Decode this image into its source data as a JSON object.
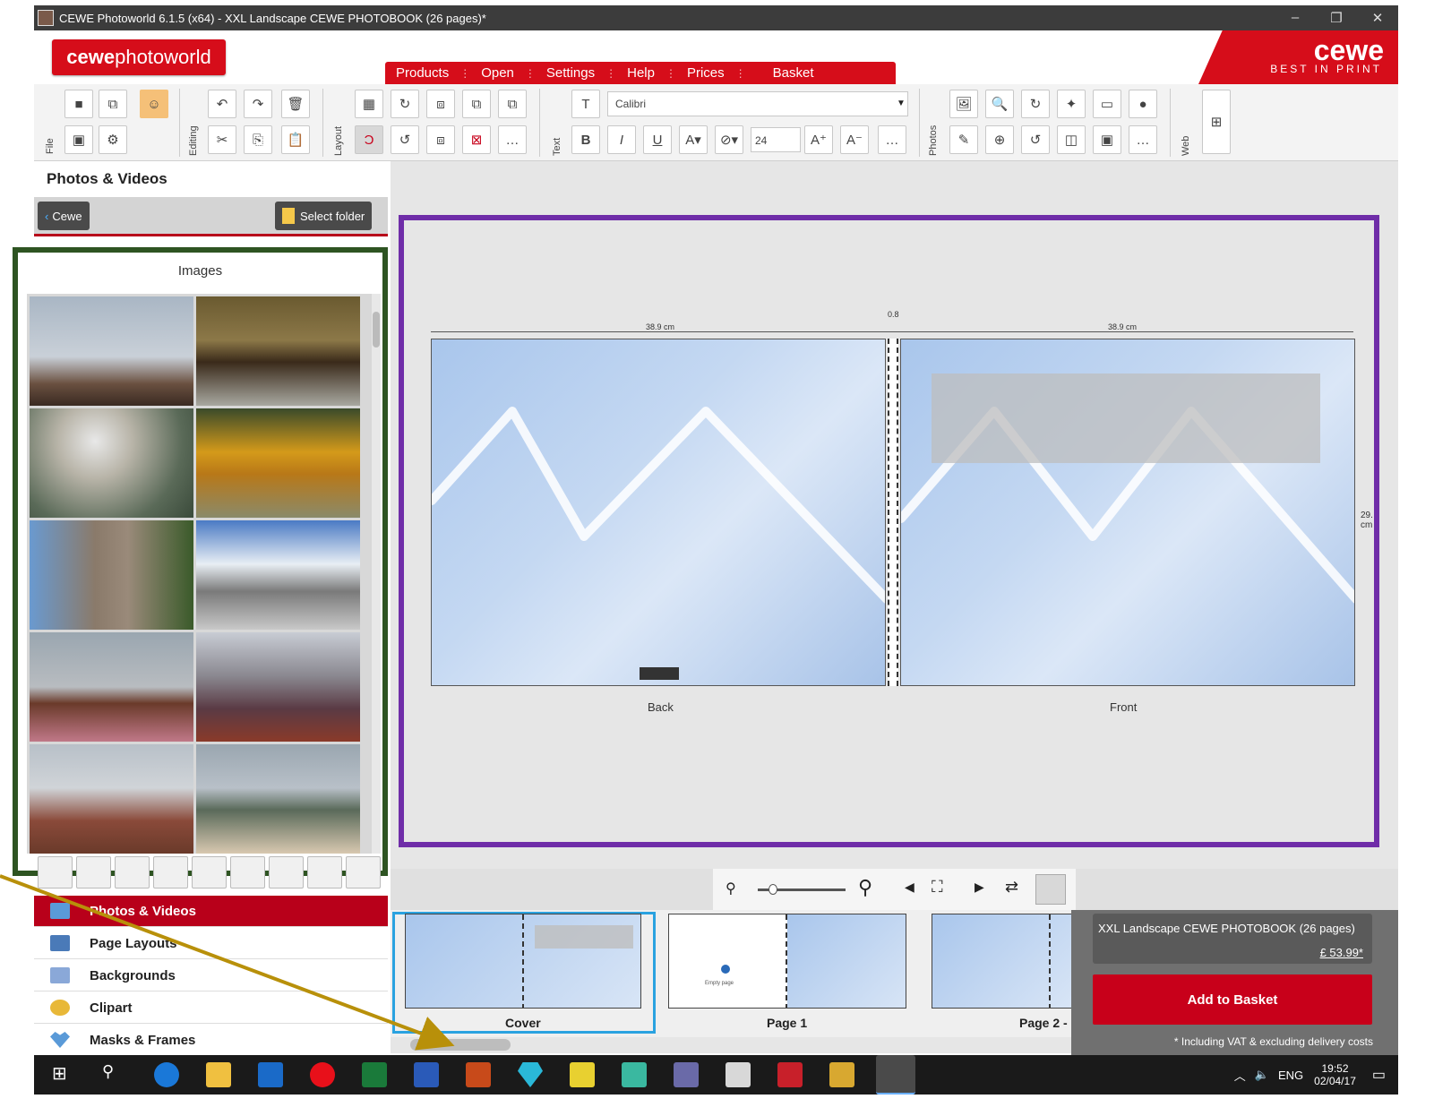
{
  "window": {
    "title": "CEWE Photoworld 6.1.5 (x64) - XXL Landscape CEWE PHOTOBOOK (26 pages)*",
    "minimize": "–",
    "restore": "❐",
    "close": "✕"
  },
  "header": {
    "logo_bold": "cewe",
    "logo_light": "photoworld",
    "brand_big": "cewe",
    "brand_small": "BEST IN PRINT",
    "menu": [
      "Products",
      "Open",
      "Settings",
      "Help",
      "Prices",
      "Basket"
    ]
  },
  "toolbar": {
    "groups": {
      "file": "File",
      "editing": "Editing",
      "layout": "Layout",
      "text": "Text",
      "photos": "Photos",
      "web": "Web"
    },
    "font_name": "Calibri",
    "font_size": "24",
    "bold": "B",
    "italic": "I",
    "underline": "U",
    "grow": "A⁺",
    "shrink": "A⁻",
    "more": "…"
  },
  "left_panel": {
    "title": "Photos & Videos",
    "back_button": "Cewe",
    "select_folder": "Select folder",
    "images_title": "Images",
    "categories": [
      "Photos & Videos",
      "Page Layouts",
      "Backgrounds",
      "Clipart",
      "Masks & Frames"
    ]
  },
  "canvas": {
    "width_left": "38.9 cm",
    "spine": "0.8",
    "width_right": "38.9 cm",
    "height": "29.  cm",
    "back_label": "Back",
    "front_label": "Front"
  },
  "filmstrip": {
    "items": [
      "Cover",
      "Page 1",
      "Page 2 -"
    ],
    "empty_page": "Empty page"
  },
  "order": {
    "product": "XXL Landscape CEWE PHOTOBOOK (26 pages)",
    "price": "£ 53.99*",
    "add_button": "Add to Basket",
    "vat_note": "* Including VAT & excluding delivery costs"
  },
  "taskbar": {
    "lang": "ENG",
    "time": "19:52",
    "date": "02/04/17"
  },
  "colors": {
    "brand_red": "#d60d1a",
    "frame_green": "#2e5422",
    "frame_purple": "#6f2da8",
    "arrow_gold": "#b8900a"
  }
}
